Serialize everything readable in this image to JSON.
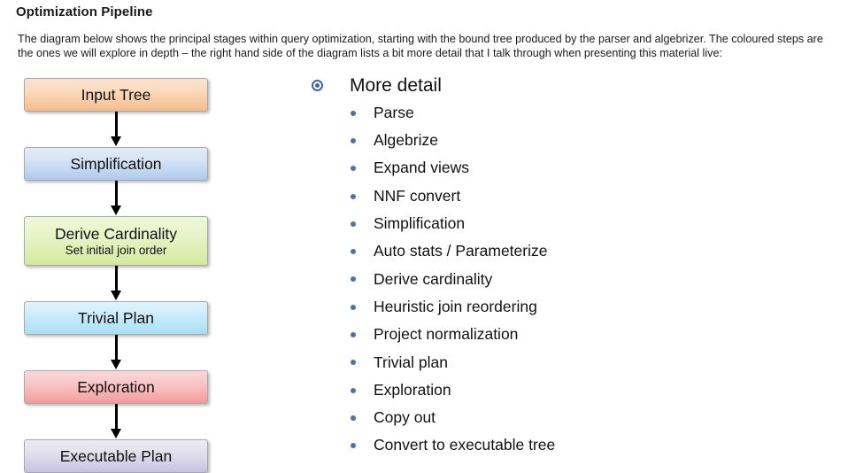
{
  "header": {
    "title": "Optimization Pipeline",
    "paragraph": "The diagram below shows the principal stages within query optimization, starting with the bound tree produced by the parser and algebrizer.  The coloured steps are the ones we will explore in depth – the right hand side of the diagram lists a bit more detail that I talk through when presenting this material live:"
  },
  "flow": {
    "nodes": [
      {
        "title": "Input Tree",
        "subtitle": "",
        "color": "#f6c79c"
      },
      {
        "title": "Simplification",
        "subtitle": "",
        "color": "#b9d0ef"
      },
      {
        "title": "Derive Cardinality",
        "subtitle": "Set initial join order",
        "color": "#d8ecaa"
      },
      {
        "title": "Trivial Plan",
        "subtitle": "",
        "color": "#b2e2f7"
      },
      {
        "title": "Exploration",
        "subtitle": "",
        "color": "#f5a6a6"
      },
      {
        "title": "Executable Plan",
        "subtitle": "",
        "color": "#cfcae5"
      }
    ]
  },
  "detail": {
    "heading": "More detail",
    "bullet_color": "#4a72ab",
    "items": [
      "Parse",
      "Algebrize",
      "Expand views",
      "NNF convert",
      "Simplification",
      "Auto stats / Parameterize",
      "Derive cardinality",
      "Heuristic join reordering",
      "Project normalization",
      "Trivial plan",
      "Exploration",
      "Copy out",
      "Convert to executable tree"
    ]
  }
}
